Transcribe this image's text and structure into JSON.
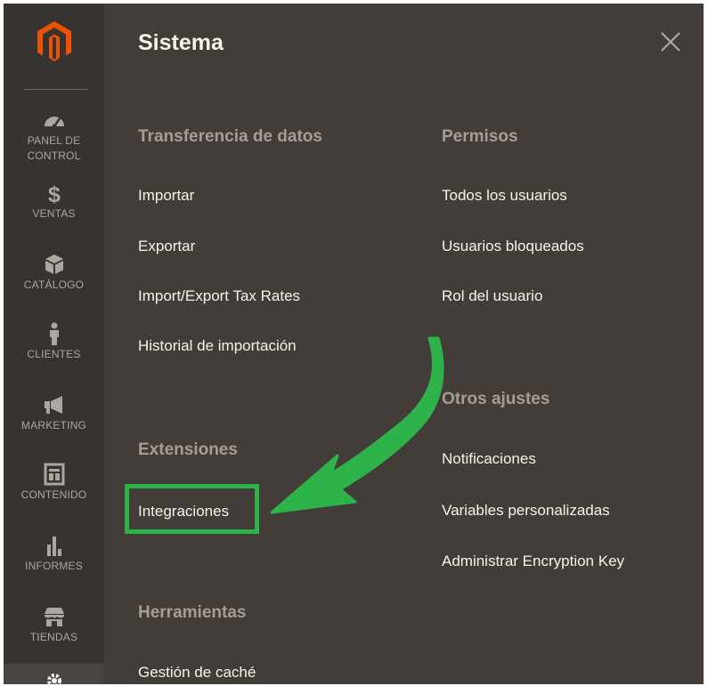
{
  "sidebar": {
    "items": [
      {
        "label_lines": [
          "PANEL DE",
          "CONTROL"
        ],
        "icon": "dashboard-icon"
      },
      {
        "label_lines": [
          "VENTAS"
        ],
        "icon": "dollar-icon"
      },
      {
        "label_lines": [
          "CATÁLOGO"
        ],
        "icon": "box-icon"
      },
      {
        "label_lines": [
          "CLIENTES"
        ],
        "icon": "person-icon"
      },
      {
        "label_lines": [
          "MARKETING"
        ],
        "icon": "megaphone-icon"
      },
      {
        "label_lines": [
          "CONTENIDO"
        ],
        "icon": "layout-icon"
      },
      {
        "label_lines": [
          "INFORMES"
        ],
        "icon": "bar-chart-icon"
      },
      {
        "label_lines": [
          "TIENDAS"
        ],
        "icon": "store-icon"
      }
    ],
    "active_icon": "gear-icon"
  },
  "panel": {
    "title": "Sistema",
    "columns": {
      "left": [
        {
          "title": "Transferencia de datos",
          "links": [
            "Importar",
            "Exportar",
            "Import/Export Tax Rates",
            "Historial de importación"
          ]
        },
        {
          "title": "Extensiones",
          "links": [
            "Integraciones"
          ]
        },
        {
          "title": "Herramientas",
          "links": [
            "Gestión de caché"
          ]
        }
      ],
      "right": [
        {
          "title": "Permisos",
          "links": [
            "Todos los usuarios",
            "Usuarios bloqueados",
            "Rol del usuario"
          ]
        },
        {
          "title": "Otros ajustes",
          "links": [
            "Notificaciones",
            "Variables personalizadas",
            "Administrar Encryption Key"
          ]
        }
      ]
    }
  },
  "colors": {
    "sidebar_bg": "#373330",
    "panel_bg": "#423d39",
    "accent_orange": "#eb5202",
    "highlight_green": "#2db34a",
    "link_text": "#f7f3eb",
    "group_title_text": "#a79d95"
  }
}
